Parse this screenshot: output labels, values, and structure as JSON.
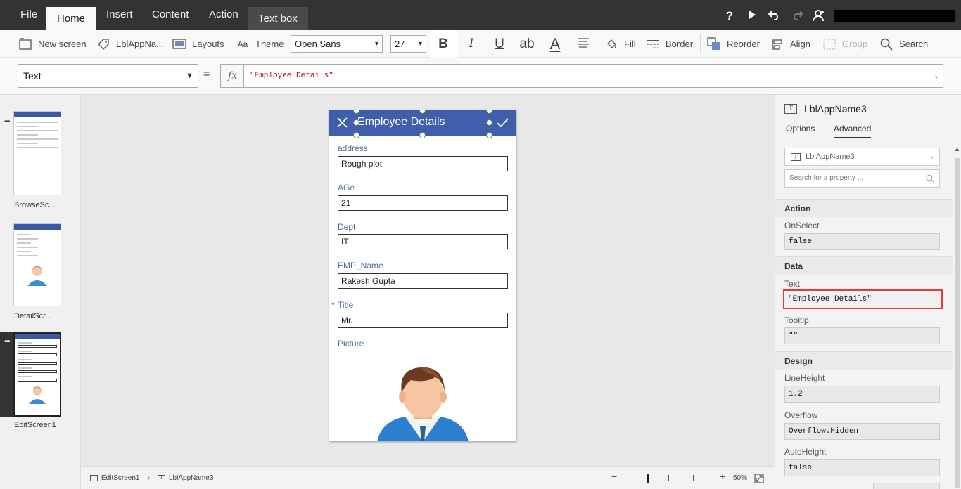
{
  "menu": {
    "tabs": [
      {
        "label": "File"
      },
      {
        "label": "Home"
      },
      {
        "label": "Insert"
      },
      {
        "label": "Content"
      },
      {
        "label": "Action"
      },
      {
        "label": "Text box"
      }
    ]
  },
  "ribbon": {
    "new_screen": "New screen",
    "control_name": "LblAppNa...",
    "layouts": "Layouts",
    "theme": "Theme",
    "font": "Open Sans",
    "font_size": "27",
    "fill": "Fill",
    "border": "Border",
    "reorder": "Reorder",
    "align": "Align",
    "group": "Group",
    "search": "Search",
    "strike_label": "ab",
    "font_color_label": "A"
  },
  "formula": {
    "property": "Text",
    "equals": "=",
    "fx": "fx",
    "value": "\"Employee Details\""
  },
  "thumbnails": [
    {
      "label": "BrowseSc..."
    },
    {
      "label": "DetailScr..."
    },
    {
      "label": "EditScreen1"
    }
  ],
  "screen": {
    "title": "Employee Details",
    "required_mark": "*",
    "fields": [
      {
        "label": "address",
        "value": "Rough plot"
      },
      {
        "label": "AGe",
        "value": "21"
      },
      {
        "label": "Dept",
        "value": "IT"
      },
      {
        "label": "EMP_Name",
        "value": "Rakesh Gupta"
      },
      {
        "label": "Title",
        "value": "Mr."
      }
    ],
    "picture_label": "Picture"
  },
  "statusbar": {
    "screen": "EditScreen1",
    "control": "LblAppName3",
    "zoom": "50%",
    "zoom_level": 0.5
  },
  "properties": {
    "control": "LblAppName3",
    "tabs": {
      "options": "Options",
      "advanced": "Advanced"
    },
    "control_select": "LblAppName3",
    "search_placeholder": "Search for a property ...",
    "sections": {
      "action": "Action",
      "data": "Data",
      "design": "Design"
    },
    "onselect": {
      "label": "OnSelect",
      "value": "false"
    },
    "text": {
      "label": "Text",
      "value": "\"Employee Details\""
    },
    "tooltip": {
      "label": "Tooltip",
      "value": "\"\""
    },
    "lineheight": {
      "label": "LineHeight",
      "value": "1.2"
    },
    "overflow": {
      "label": "Overflow",
      "value": "Overflow.Hidden"
    },
    "autoheight": {
      "label": "AutoHeight",
      "value": "false"
    }
  },
  "colors": {
    "menubar": "#333333",
    "screen_header": "#3f5fad",
    "field_label": "#4a6fa5",
    "focus_border": "#e5393a"
  }
}
